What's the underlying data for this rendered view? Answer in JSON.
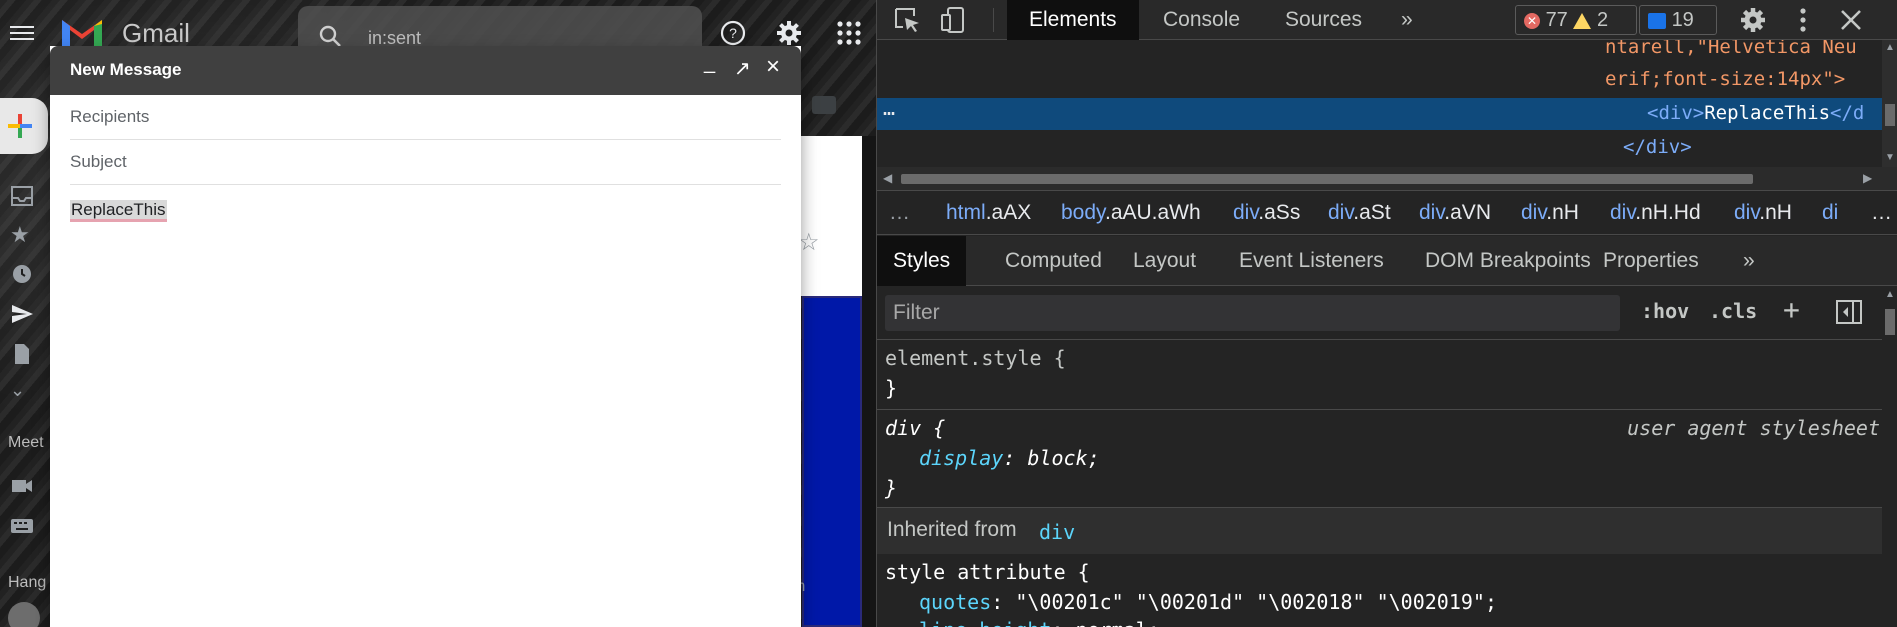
{
  "gmail": {
    "app_name": "Gmail",
    "search": {
      "value": "in:sent"
    },
    "left_labels": {
      "meet": "Meet",
      "hangouts": "Hang"
    },
    "snippet_char": "m"
  },
  "compose": {
    "title": "New Message",
    "minimize": "_",
    "popout": "↗",
    "close": "×",
    "recipients_placeholder": "Recipients",
    "subject_placeholder": "Subject",
    "body_text": "ReplaceThis"
  },
  "devtools": {
    "tabs": [
      "Elements",
      "Console",
      "Sources"
    ],
    "more_tabs": "»",
    "errors": "77",
    "warnings": "2",
    "messages": "19",
    "dom": {
      "line1": "ntarell,\"Helvetica Neu",
      "line2": "erif;font-size:14px\">",
      "selected_open": "<div>",
      "selected_text": "ReplaceThis",
      "selected_close": "</d",
      "line4": "</div>",
      "dots": "…"
    },
    "breadcrumbs": [
      {
        "tag": "html",
        "cls": ".aAX"
      },
      {
        "tag": "body",
        "cls": ".aAU.aWh"
      },
      {
        "tag": "div",
        "cls": ".aSs"
      },
      {
        "tag": "div",
        "cls": ".aSt"
      },
      {
        "tag": "div",
        "cls": ".aVN"
      },
      {
        "tag": "div",
        "cls": ".nH"
      },
      {
        "tag": "div",
        "cls": ".nH.Hd"
      },
      {
        "tag": "div",
        "cls": ".nH"
      },
      {
        "tag": "di",
        "cls": ""
      }
    ],
    "breadcrumb_lead": "…",
    "breadcrumb_tail": "…",
    "sub_tabs": [
      "Styles",
      "Computed",
      "Layout",
      "Event Listeners",
      "DOM Breakpoints",
      "Properties"
    ],
    "sub_more": "»",
    "filter_placeholder": "Filter",
    "hov": ":hov",
    "cls": ".cls",
    "plus": "+",
    "styles": {
      "element_style": "element.style {",
      "close_brace": "}",
      "div_rule": "div {",
      "ua_label": "user agent stylesheet",
      "display_prop": "display",
      "display_val": "block;",
      "inherited_label": "Inherited from",
      "inherited_link": "div",
      "style_attr": "style attribute {",
      "quotes_prop": "quotes",
      "quotes_val": "\"\\00201c\" \"\\00201d\" \"\\002018\" \"\\002019\";",
      "line_height_prop": "line-height",
      "line_height_val": "normal;"
    }
  }
}
